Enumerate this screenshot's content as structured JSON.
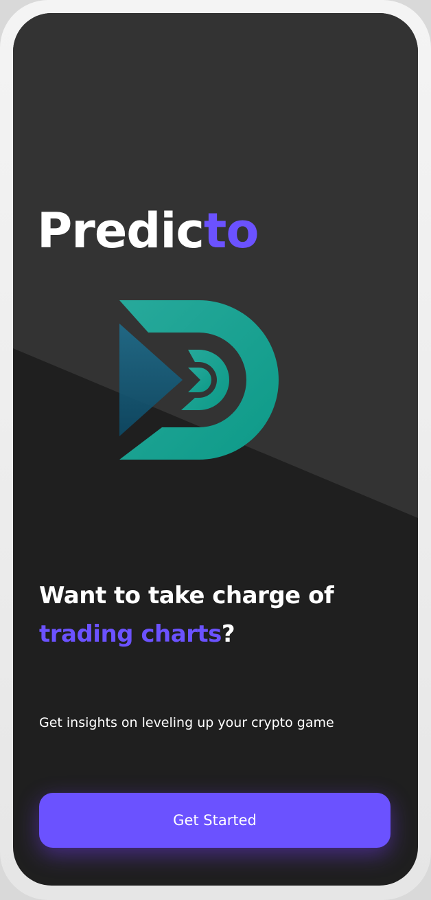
{
  "brand": {
    "name_part1": "Predic",
    "name_part2": "to",
    "logo_icon": "predicto-logo-icon"
  },
  "hero": {
    "headline_line1": "Want to take charge of",
    "headline_highlight": "trading charts",
    "headline_end": "?",
    "subtitle": "Get insights on leveling up your crypto game"
  },
  "cta": {
    "label": "Get Started"
  },
  "colors": {
    "accent": "#6b52ff",
    "teal": "#1aa08f",
    "background_dark": "#1f1f1f",
    "background_light": "#333333",
    "text": "#ffffff"
  }
}
